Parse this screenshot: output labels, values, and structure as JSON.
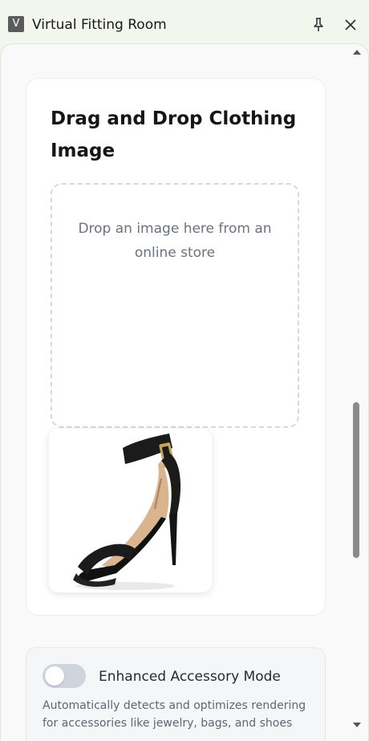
{
  "window": {
    "app_icon_letter": "V",
    "title": "Virtual Fitting Room",
    "pin_icon": "pin-icon",
    "close_icon": "close-icon"
  },
  "upload_card": {
    "heading": "Drag and Drop Clothing Image",
    "dropzone_text": "Drop an image here from an online store",
    "preview_image": "black-strappy-high-heel-sandal"
  },
  "accessory_mode": {
    "label": "Enhanced Accessory Mode",
    "description": "Automatically detects and optimizes rendering for accessories like jewelry, bags, and shoes",
    "enabled": false
  },
  "colors": {
    "titlebar_bg": "#f2f6ec",
    "panel_bg": "#f8f9f8",
    "toggle_off": "#cfd5dd",
    "muted_text": "#6b7280"
  }
}
